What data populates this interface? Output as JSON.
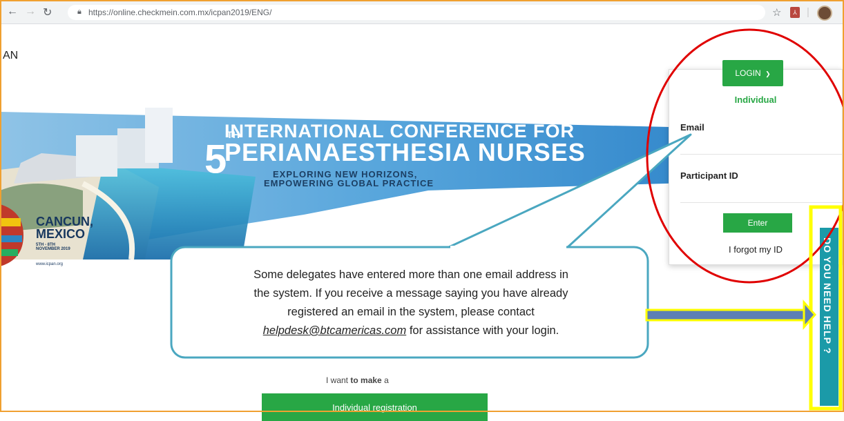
{
  "browser": {
    "url": "https://online.checkmein.com.mx/icpan2019/ENG/"
  },
  "header": {
    "brand_fragment": "AN"
  },
  "banner": {
    "ordinal_number": "5",
    "ordinal_suffix": "TH",
    "title_line1": "INTERNATIONAL CONFERENCE FOR",
    "title_line2": "PERIANAESTHESIA NURSES",
    "tagline_line1": "EXPLORING NEW HORIZONS,",
    "tagline_line2": "EMPOWERING GLOBAL PRACTICE",
    "location_line1": "CANCUN,",
    "location_line2": "MEXICO",
    "dates": "5TH - 8TH",
    "dates_sub": "NOVEMBER 2019",
    "website": "www.icpan.org"
  },
  "login": {
    "button_label": "LOGIN",
    "tab_title": "Individual",
    "email_label": "Email",
    "email_value": "",
    "participant_label": "Participant ID",
    "participant_value": "",
    "enter_label": "Enter",
    "forgot_label": "I forgot my ID"
  },
  "help_tab": {
    "label": "DO YOU NEED HELP ?"
  },
  "registration": {
    "prompt_pre": "I want",
    "prompt_bold": "to make",
    "prompt_post": "a",
    "individual_button": "Individual registration"
  },
  "annotation": {
    "line1": "Some delegates have entered more than one email address in",
    "line2": "the system. If you receive a message saying you have already",
    "line3": "registered an email in the system, please contact",
    "email": "helpdesk@btcamericas.com",
    "line4_tail": " for assistance with your login.",
    "highlight_colors": {
      "ellipse": "#e00000",
      "box": "#ffff00",
      "arrow": "#5b7fb5",
      "callout_border": "#4aa7c0"
    }
  }
}
